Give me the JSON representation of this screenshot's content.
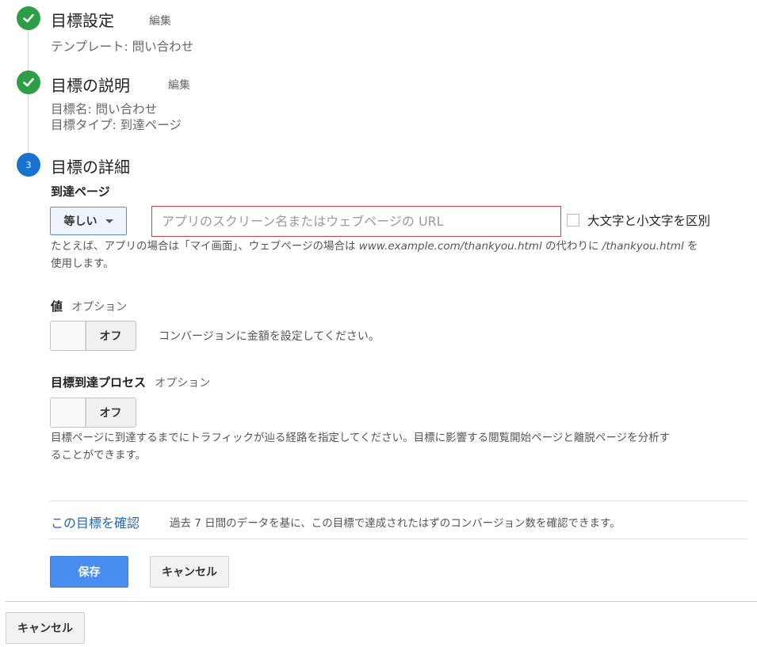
{
  "steps": [
    {
      "title": "目標設定",
      "edit": "編集",
      "details": [
        "テンプレート: 問い合わせ"
      ],
      "status": "complete"
    },
    {
      "title": "目標の説明",
      "edit": "編集",
      "details": [
        "目標名: 問い合わせ",
        "目標タイプ: 到達ページ"
      ],
      "status": "complete"
    },
    {
      "number": "3",
      "title": "目標の詳細",
      "status": "current"
    }
  ],
  "destination": {
    "label": "到達ページ",
    "match_type": "等しい",
    "url_placeholder": "アプリのスクリーン名またはウェブページの URL",
    "url_value": "",
    "case_sensitive_label": "大文字と小文字を区別",
    "case_sensitive_checked": false,
    "hint_part1": "たとえば、アプリの場合は「マイ画面」、ウェブページの場合は ",
    "hint_example1": "www.example.com/thankyou.html",
    "hint_part2": " の代わりに ",
    "hint_example2": "/thankyou.html",
    "hint_part3": " を",
    "hint_line2": "使用します。"
  },
  "value": {
    "label": "値",
    "optional": "オプション",
    "toggle_label": "オフ",
    "toggle_on": false,
    "description": "コンバージョンに金額を設定してください。"
  },
  "funnel": {
    "label": "目標到達プロセス",
    "optional": "オプション",
    "toggle_label": "オフ",
    "toggle_on": false,
    "description_line1": "目標ページに到達するまでにトラフィックが辿る経路を指定してください。目標に影響する閲覧開始ページと離脱ページを分析す",
    "description_line2": "ることができます。"
  },
  "verify": {
    "link": "この目標を確認",
    "description": "過去 7 日間のデータを基に、この目標で達成されたはずのコンバージョン数を確認できます。"
  },
  "actions": {
    "save": "保存",
    "cancel": "キャンセル"
  },
  "footer": {
    "cancel": "キャンセル"
  },
  "colors": {
    "complete": "#2e9e44",
    "current": "#1a73d1",
    "primary": "#4a8df0",
    "link": "#2166b8",
    "error_border": "#c9434a"
  }
}
